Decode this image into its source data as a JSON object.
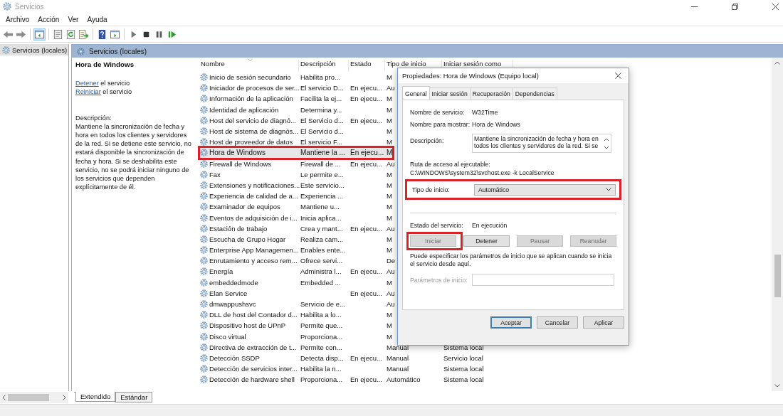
{
  "window": {
    "title": "Servicios"
  },
  "menu": [
    "Archivo",
    "Acción",
    "Ver",
    "Ayuda"
  ],
  "tree": {
    "items": [
      {
        "label": "Servicios (locales)",
        "selected": true
      }
    ]
  },
  "panel": {
    "title": "Servicios (locales)"
  },
  "details": {
    "name": "Hora de Windows",
    "actions": [
      {
        "link": "Detener",
        "text": "el servicio"
      },
      {
        "link": "Reiniciar",
        "text": "el servicio"
      }
    ],
    "description_label": "Descripción:",
    "description": "Mantiene la sincronización de fecha y hora en todos los clientes y servidores de la red. Si se detiene este servicio, no estará disponible la sincronización de fecha y hora. Si se deshabilita este servicio, no se podrá iniciar ninguno de los servicios que dependen explícitamente de él."
  },
  "table": {
    "columns": [
      "Nombre",
      "Descripción",
      "Estado",
      "Tipo de inicio",
      "Iniciar sesión como"
    ],
    "rows": [
      {
        "name": "Inicio de sesión secundario",
        "description": "Habilita pro...",
        "startup": "M",
        "selected": false,
        "highlighted": false
      },
      {
        "name": "Iniciador de procesos de ser...",
        "description": "El servicio D...",
        "status": "En ejecu...",
        "startup": "Au",
        "selected": false,
        "highlighted": false
      },
      {
        "name": "Información de la aplicación",
        "description": "Facilita la ej...",
        "status": "En ejecu...",
        "startup": "M",
        "selected": false,
        "highlighted": false
      },
      {
        "name": "Identidad de aplicación",
        "description": "Determina y...",
        "startup": "M",
        "selected": false,
        "highlighted": false
      },
      {
        "name": "Host del servicio de diagnó...",
        "description": "El Servicio d...",
        "status": "En ejecu...",
        "startup": "M",
        "selected": false,
        "highlighted": false
      },
      {
        "name": "Host de sistema de diagnós...",
        "description": "El Servicio d...",
        "startup": "M",
        "selected": false,
        "highlighted": false
      },
      {
        "name": "Host de proveedor de datos",
        "description": "El servicio F...",
        "startup": "M",
        "selected": false,
        "highlighted": false
      },
      {
        "name": "Hora de Windows",
        "description": "Mantiene la ...",
        "status": "En ejecu...",
        "startup": "M",
        "selected": true,
        "highlighted": true
      },
      {
        "name": "Firewall de Windows",
        "description": "Firewall de ...",
        "status": "En ejecu...",
        "startup": "Au",
        "selected": false,
        "highlighted": false
      },
      {
        "name": "Fax",
        "description": "Le permite e...",
        "startup": "M",
        "selected": false,
        "highlighted": false
      },
      {
        "name": "Extensiones y notificaciones...",
        "description": "Este servicio...",
        "startup": "M",
        "selected": false,
        "highlighted": false
      },
      {
        "name": "Experiencia de calidad de a...",
        "description": "Experiencia ...",
        "startup": "M",
        "selected": false,
        "highlighted": false
      },
      {
        "name": "Examinador de equipos",
        "description": "Mantiene u...",
        "startup": "M",
        "selected": false,
        "highlighted": false
      },
      {
        "name": "Eventos de adquisición de i...",
        "description": "Inicia aplica...",
        "startup": "M",
        "selected": false,
        "highlighted": false
      },
      {
        "name": "Estación de trabajo",
        "description": "Crea y mant...",
        "status": "En ejecu...",
        "startup": "Au",
        "selected": false,
        "highlighted": false
      },
      {
        "name": "Escucha de Grupo Hogar",
        "description": "Realiza cam...",
        "startup": "M",
        "selected": false,
        "highlighted": false
      },
      {
        "name": "Enterprise App Managemen...",
        "description": "Enables ente...",
        "startup": "M",
        "selected": false,
        "highlighted": false
      },
      {
        "name": "Enrutamiento y acceso rem...",
        "description": "Ofrece servi...",
        "startup": "De",
        "selected": false,
        "highlighted": false
      },
      {
        "name": "Energía",
        "description": "Administra l...",
        "status": "En ejecu...",
        "startup": "Au",
        "selected": false,
        "highlighted": false
      },
      {
        "name": "embeddedmode",
        "description": "Embedded ...",
        "startup": "M",
        "selected": false,
        "highlighted": false
      },
      {
        "name": "Elan Service",
        "status": "En ejecu...",
        "startup": "Au",
        "selected": false,
        "highlighted": false
      },
      {
        "name": "dmwappushsvc",
        "description": "Servicio de e...",
        "startup": "Au",
        "selected": false,
        "highlighted": false
      },
      {
        "name": "DLL de host del Contador d...",
        "description": "Habilita a lo...",
        "startup": "M",
        "selected": false,
        "highlighted": false
      },
      {
        "name": "Dispositivo host de UPnP",
        "description": "Permite que...",
        "startup": "M",
        "selected": false,
        "highlighted": false
      },
      {
        "name": "Disco virtual",
        "description": "Proporciona...",
        "startup": "M",
        "selected": false,
        "highlighted": false
      },
      {
        "name": "Directiva de extracción de t...",
        "description": "Permite con...",
        "startup": "Manual",
        "logon": "Sistema local",
        "selected": false,
        "highlighted": false
      },
      {
        "name": "Detección SSDP",
        "description": "Detecta disp...",
        "status": "En ejecu...",
        "startup": "Manual",
        "logon": "Servicio local",
        "selected": false,
        "highlighted": false
      },
      {
        "name": "Detección de servicios inter...",
        "description": "Habilita la n...",
        "startup": "Manual",
        "logon": "Sistema local",
        "selected": false,
        "highlighted": false
      },
      {
        "name": "Detección de hardware shell",
        "description": "Proporciona...",
        "status": "En ejecu...",
        "startup": "Automático",
        "logon": "Sistema local",
        "selected": false,
        "highlighted": false
      }
    ]
  },
  "view_tabs": [
    {
      "label": "Extendido",
      "selected": true
    },
    {
      "label": "Estándar",
      "selected": false
    }
  ],
  "dialog": {
    "title": "Propiedades: Hora de Windows (Equipo local)",
    "tabs": [
      {
        "label": "General",
        "selected": true
      },
      {
        "label": "Iniciar sesión",
        "selected": false
      },
      {
        "label": "Recuperación",
        "selected": false
      },
      {
        "label": "Dependencias",
        "selected": false
      }
    ],
    "fields": [
      {
        "label": "Nombre de servicio:",
        "value": "W32Time"
      },
      {
        "label": "Nombre para mostrar:",
        "value": "Hora de Windows"
      }
    ],
    "description": {
      "label": "Descripción:",
      "value": "Mantiene la sincronización de fecha y hora en todos los clientes y servidores de la red. Si se"
    },
    "path": {
      "label": "Ruta de acceso al ejecutable:",
      "value": "C:\\WINDOWS\\system32\\svchost.exe -k LocalService"
    },
    "startup_type": {
      "label": "Tipo de inicio:",
      "value": "Automático",
      "highlighted": true
    },
    "service_status": {
      "label": "Estado del servicio:",
      "value": "En ejecución"
    },
    "control_buttons": [
      {
        "label": "Iniciar",
        "disabled": true,
        "highlighted": true
      },
      {
        "label": "Detener",
        "disabled": false,
        "highlighted": false
      },
      {
        "label": "Pausar",
        "disabled": true,
        "highlighted": false
      },
      {
        "label": "Reanudar",
        "disabled": true,
        "highlighted": false
      }
    ],
    "hint": "Puede especificar los parámetros de inicio que se aplican cuando se inicia el servicio desde aquí.",
    "parameters": {
      "label": "Parámetros de inicio:",
      "disabled": true
    },
    "buttons": [
      {
        "label": "Aceptar",
        "default": true
      },
      {
        "label": "Cancelar",
        "default": false
      },
      {
        "label": "Aplicar",
        "default": false
      }
    ]
  }
}
